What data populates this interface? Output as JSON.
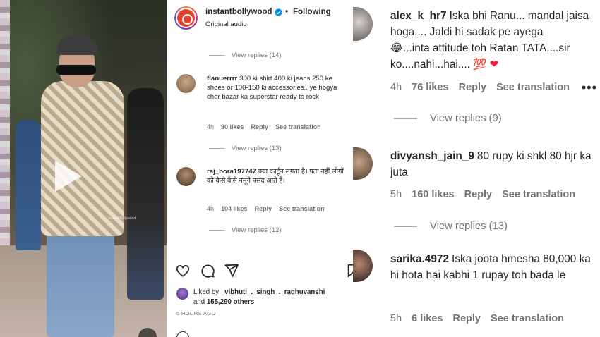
{
  "post": {
    "username": "instantbollywood",
    "follow_status": "Following",
    "audio": "Original audio",
    "watermark": "Instant Bollywood"
  },
  "thread": [
    {
      "type": "replies",
      "label": "View replies (14)"
    },
    {
      "type": "comment",
      "user": "flanuerrrr",
      "text": "300 ki shirt 400 ki jeans 250 ke shoes or 100-150 ki accessories.. ye hogya chor bazar ka superstar ready to rock",
      "time": "4h",
      "likes": "90 likes",
      "reply": "Reply",
      "translate": "See translation"
    },
    {
      "type": "replies",
      "label": "View replies (13)"
    },
    {
      "type": "comment",
      "user": "raj_bora197747",
      "text": "क्या कार्टून लगता है। पता नहीं लोगों को कैसे कैसे नमूने पसंद आते हैं।",
      "time": "4h",
      "likes": "104 likes",
      "reply": "Reply",
      "translate": "See translation"
    },
    {
      "type": "replies",
      "label": "View replies (12)"
    }
  ],
  "likes": {
    "prefix": "Liked by",
    "user": "_vibhuti_._singh_._raghuvanshi",
    "joiner": "and",
    "others": "155,290 others"
  },
  "posted": "5 HOURS AGO",
  "zoom": {
    "comments": [
      {
        "user": "alex_k_hr7",
        "text": "Iska bhi Ranu... mandal jaisa hoga.... Jaldi hi sadak pe ayega",
        "text2": "...inta attitude toh Ratan TATA....sir ko....nahi...hai....",
        "emoji_laugh": "😂",
        "emoji_hundred": "💯",
        "emoji_heart": "❤",
        "time": "4h",
        "likes": "76 likes",
        "reply": "Reply",
        "translate": "See translation",
        "more": "•••"
      },
      {
        "user": "divyansh_jain_9",
        "text": "80 rupy ki shkl 80 hjr ka juta",
        "time": "5h",
        "likes": "160 likes",
        "reply": "Reply",
        "translate": "See translation"
      },
      {
        "user": "sarika.4972",
        "text": "Iska joota hmesha 80,000 ka hi hota hai kabhi 1 rupay toh bada le",
        "time": "5h",
        "likes": "6 likes",
        "reply": "Reply",
        "translate": "See translation"
      }
    ],
    "replies": [
      "View replies (9)",
      "View replies (13)"
    ]
  },
  "icons": [
    "play-icon",
    "verified-icon",
    "heart-icon",
    "comment-icon",
    "share-icon",
    "bookmark-icon",
    "more-icon"
  ],
  "colors": {
    "verified": "#0095f6",
    "secondary_text": "#737373",
    "heart_red": "#ed1c3a"
  }
}
